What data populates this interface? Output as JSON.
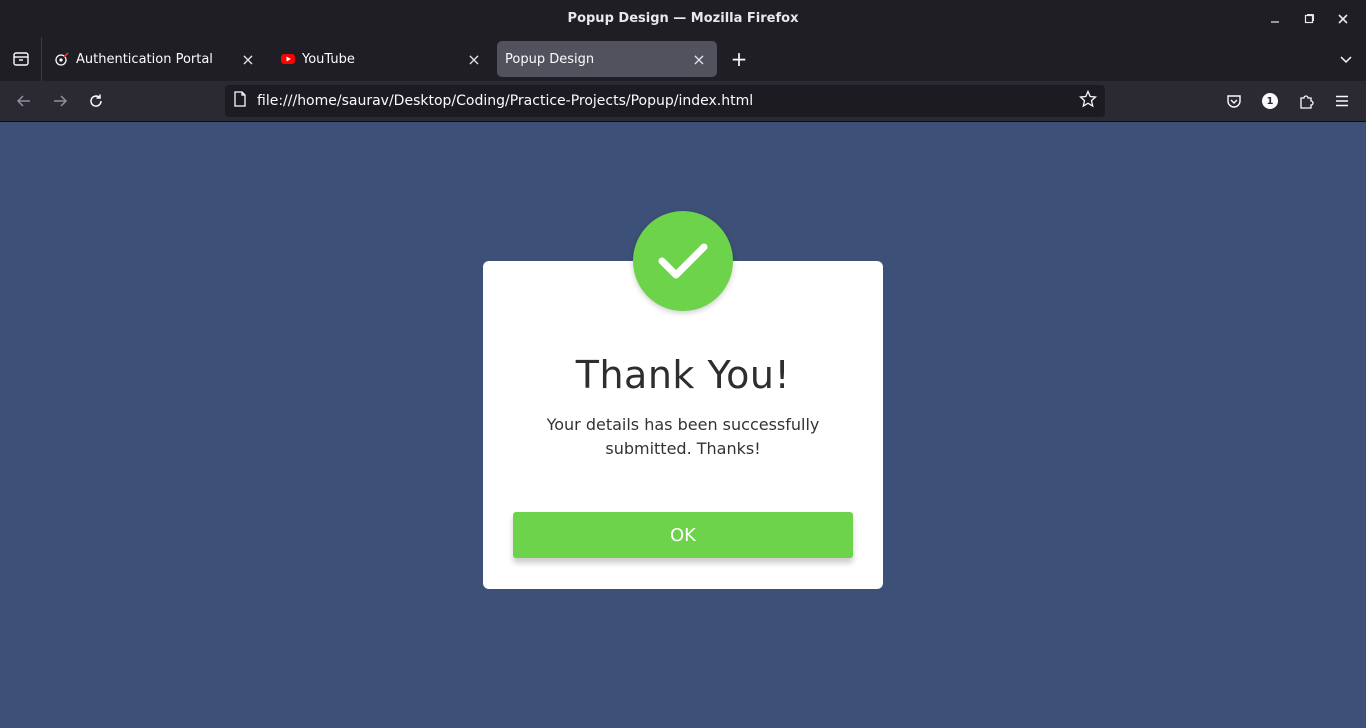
{
  "window": {
    "title": "Popup Design — Mozilla Firefox"
  },
  "tabs": [
    {
      "label": "Authentication Portal",
      "icon": "portal-favicon-icon",
      "active": false
    },
    {
      "label": "YouTube",
      "icon": "youtube-icon",
      "active": false
    },
    {
      "label": "Popup Design",
      "icon": "",
      "active": true
    }
  ],
  "navbar": {
    "url": "file:///home/saurav/Desktop/Coding/Practice-Projects/Popup/index.html",
    "extension_badge": "1"
  },
  "popup": {
    "heading": "Thank You!",
    "message": "Your details has been successfully submitted. Thanks!",
    "ok_label": "OK"
  },
  "colors": {
    "page_background": "#3d5078",
    "accent_green": "#6cd34b",
    "card": "#ffffff"
  }
}
